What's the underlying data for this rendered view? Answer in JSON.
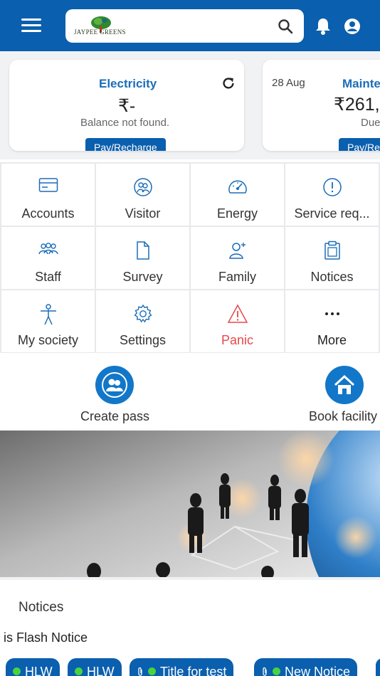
{
  "header": {
    "logo_text": "JAYPEE GREENS",
    "icons": [
      "menu-icon",
      "search-icon",
      "bell-icon",
      "user-icon"
    ]
  },
  "cards": [
    {
      "title": "Electricity",
      "amount": "₹-",
      "subtitle": "Balance not found.",
      "button": "Pay/Recharge",
      "date": ""
    },
    {
      "title": "Mainte",
      "amount": "₹261,",
      "subtitle": "Due",
      "button": "Pay/Re",
      "date": "28 Aug"
    }
  ],
  "menu": [
    {
      "label": "Accounts",
      "icon": "card-icon"
    },
    {
      "label": "Visitor",
      "icon": "visitor-icon"
    },
    {
      "label": "Energy",
      "icon": "gauge-icon"
    },
    {
      "label": "Service req...",
      "icon": "alert-circle-icon"
    },
    {
      "label": "Staff",
      "icon": "group-icon"
    },
    {
      "label": "Survey",
      "icon": "document-icon"
    },
    {
      "label": "Family",
      "icon": "person-add-icon"
    },
    {
      "label": "Notices",
      "icon": "clipboard-icon"
    },
    {
      "label": "My society",
      "icon": "person-icon"
    },
    {
      "label": "Settings",
      "icon": "gear-icon"
    },
    {
      "label": "Panic",
      "icon": "warning-icon"
    },
    {
      "label": "More",
      "icon": "ellipsis-icon"
    }
  ],
  "quick_actions": [
    {
      "label": "Create pass",
      "icon": "people-icon"
    },
    {
      "label": "Book facility",
      "icon": "home-icon"
    }
  ],
  "notices": {
    "heading": "Notices",
    "flash": "is Flash Notice",
    "chips": [
      "HLW",
      "HLW",
      "Title for test",
      "New Notice"
    ]
  },
  "colors": {
    "primary": "#0a5fae",
    "panic": "#e8484a",
    "dot": "#49d33f"
  }
}
